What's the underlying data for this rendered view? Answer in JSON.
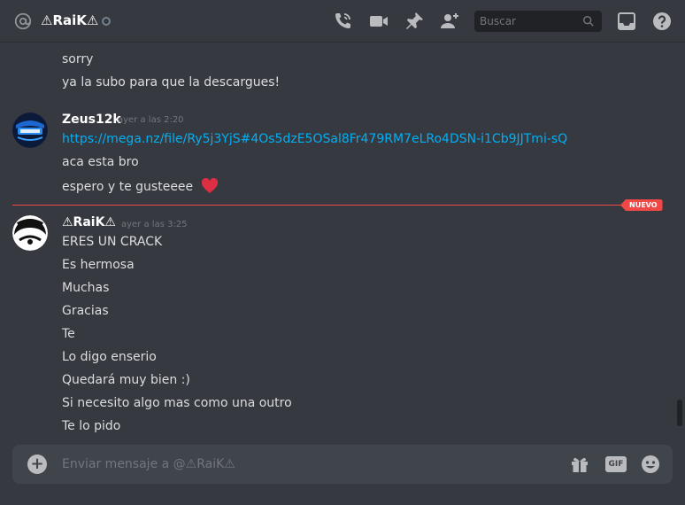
{
  "header": {
    "dm_name": "⚠RaiK⚠",
    "search_placeholder": "Buscar",
    "icons": [
      "at-icon",
      "call-icon",
      "video-icon",
      "pin-icon",
      "add-friend-icon",
      "search-icon",
      "inbox-icon",
      "help-icon"
    ]
  },
  "messages": {
    "group1_lines": [
      "sorry",
      "ya la subo para que la descargues!"
    ],
    "group2": {
      "username": "Zeus12k",
      "timestamp": "ayer a las 2:20",
      "link": "https://mega.nz/file/Ry5j3YjS#4Os5dzE5OSal8Fr479RM7eLRo4DSN-i1Cb9JJTmi-sQ",
      "lines": [
        "aca esta bro",
        "espero y te gusteeee"
      ],
      "emoji": "heart"
    },
    "new_label": "NUEVO",
    "group3": {
      "username": "⚠RaiK⚠",
      "timestamp": "ayer a las 3:25",
      "lines": [
        "ERES UN CRACK",
        "Es hermosa",
        "Muchas",
        "Gracias",
        "Te",
        "Lo digo enserio",
        "Quedará muy bien :)",
        "Si necesito algo mas como una outro",
        "Te lo pido"
      ]
    }
  },
  "composer": {
    "placeholder": "Enviar mensaje a @⚠RaiK⚠",
    "gif_label": "GIF"
  },
  "colors": {
    "background": "#36393f",
    "link": "#00b0f4",
    "new_divider": "#f04747",
    "heart": "#dd2e44"
  }
}
